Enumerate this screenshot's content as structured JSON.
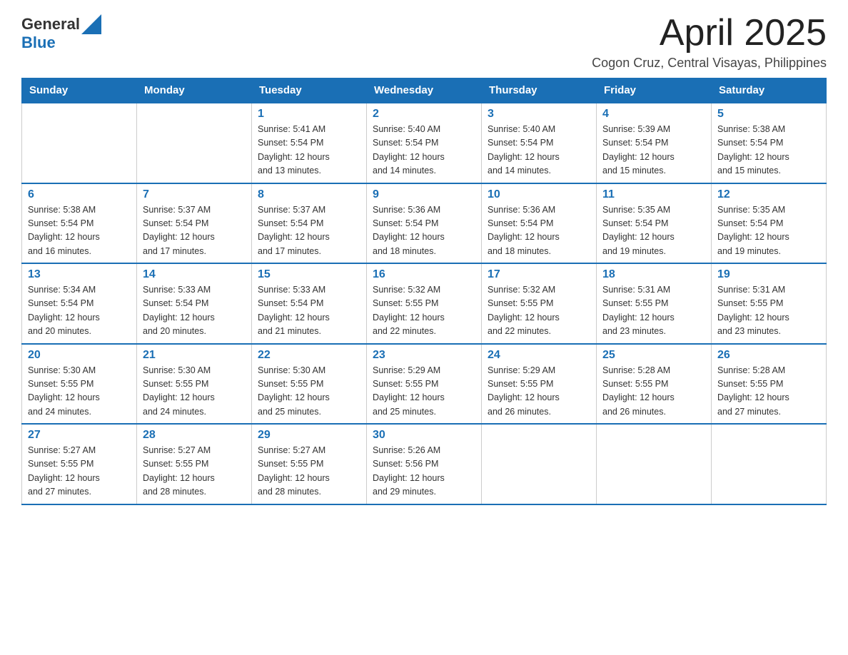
{
  "logo": {
    "text_general": "General",
    "text_blue": "Blue",
    "alt": "GeneralBlue logo"
  },
  "header": {
    "month_year": "April 2025",
    "location": "Cogon Cruz, Central Visayas, Philippines"
  },
  "weekdays": [
    "Sunday",
    "Monday",
    "Tuesday",
    "Wednesday",
    "Thursday",
    "Friday",
    "Saturday"
  ],
  "weeks": [
    [
      {
        "day": "",
        "info": ""
      },
      {
        "day": "",
        "info": ""
      },
      {
        "day": "1",
        "info": "Sunrise: 5:41 AM\nSunset: 5:54 PM\nDaylight: 12 hours\nand 13 minutes."
      },
      {
        "day": "2",
        "info": "Sunrise: 5:40 AM\nSunset: 5:54 PM\nDaylight: 12 hours\nand 14 minutes."
      },
      {
        "day": "3",
        "info": "Sunrise: 5:40 AM\nSunset: 5:54 PM\nDaylight: 12 hours\nand 14 minutes."
      },
      {
        "day": "4",
        "info": "Sunrise: 5:39 AM\nSunset: 5:54 PM\nDaylight: 12 hours\nand 15 minutes."
      },
      {
        "day": "5",
        "info": "Sunrise: 5:38 AM\nSunset: 5:54 PM\nDaylight: 12 hours\nand 15 minutes."
      }
    ],
    [
      {
        "day": "6",
        "info": "Sunrise: 5:38 AM\nSunset: 5:54 PM\nDaylight: 12 hours\nand 16 minutes."
      },
      {
        "day": "7",
        "info": "Sunrise: 5:37 AM\nSunset: 5:54 PM\nDaylight: 12 hours\nand 17 minutes."
      },
      {
        "day": "8",
        "info": "Sunrise: 5:37 AM\nSunset: 5:54 PM\nDaylight: 12 hours\nand 17 minutes."
      },
      {
        "day": "9",
        "info": "Sunrise: 5:36 AM\nSunset: 5:54 PM\nDaylight: 12 hours\nand 18 minutes."
      },
      {
        "day": "10",
        "info": "Sunrise: 5:36 AM\nSunset: 5:54 PM\nDaylight: 12 hours\nand 18 minutes."
      },
      {
        "day": "11",
        "info": "Sunrise: 5:35 AM\nSunset: 5:54 PM\nDaylight: 12 hours\nand 19 minutes."
      },
      {
        "day": "12",
        "info": "Sunrise: 5:35 AM\nSunset: 5:54 PM\nDaylight: 12 hours\nand 19 minutes."
      }
    ],
    [
      {
        "day": "13",
        "info": "Sunrise: 5:34 AM\nSunset: 5:54 PM\nDaylight: 12 hours\nand 20 minutes."
      },
      {
        "day": "14",
        "info": "Sunrise: 5:33 AM\nSunset: 5:54 PM\nDaylight: 12 hours\nand 20 minutes."
      },
      {
        "day": "15",
        "info": "Sunrise: 5:33 AM\nSunset: 5:54 PM\nDaylight: 12 hours\nand 21 minutes."
      },
      {
        "day": "16",
        "info": "Sunrise: 5:32 AM\nSunset: 5:55 PM\nDaylight: 12 hours\nand 22 minutes."
      },
      {
        "day": "17",
        "info": "Sunrise: 5:32 AM\nSunset: 5:55 PM\nDaylight: 12 hours\nand 22 minutes."
      },
      {
        "day": "18",
        "info": "Sunrise: 5:31 AM\nSunset: 5:55 PM\nDaylight: 12 hours\nand 23 minutes."
      },
      {
        "day": "19",
        "info": "Sunrise: 5:31 AM\nSunset: 5:55 PM\nDaylight: 12 hours\nand 23 minutes."
      }
    ],
    [
      {
        "day": "20",
        "info": "Sunrise: 5:30 AM\nSunset: 5:55 PM\nDaylight: 12 hours\nand 24 minutes."
      },
      {
        "day": "21",
        "info": "Sunrise: 5:30 AM\nSunset: 5:55 PM\nDaylight: 12 hours\nand 24 minutes."
      },
      {
        "day": "22",
        "info": "Sunrise: 5:30 AM\nSunset: 5:55 PM\nDaylight: 12 hours\nand 25 minutes."
      },
      {
        "day": "23",
        "info": "Sunrise: 5:29 AM\nSunset: 5:55 PM\nDaylight: 12 hours\nand 25 minutes."
      },
      {
        "day": "24",
        "info": "Sunrise: 5:29 AM\nSunset: 5:55 PM\nDaylight: 12 hours\nand 26 minutes."
      },
      {
        "day": "25",
        "info": "Sunrise: 5:28 AM\nSunset: 5:55 PM\nDaylight: 12 hours\nand 26 minutes."
      },
      {
        "day": "26",
        "info": "Sunrise: 5:28 AM\nSunset: 5:55 PM\nDaylight: 12 hours\nand 27 minutes."
      }
    ],
    [
      {
        "day": "27",
        "info": "Sunrise: 5:27 AM\nSunset: 5:55 PM\nDaylight: 12 hours\nand 27 minutes."
      },
      {
        "day": "28",
        "info": "Sunrise: 5:27 AM\nSunset: 5:55 PM\nDaylight: 12 hours\nand 28 minutes."
      },
      {
        "day": "29",
        "info": "Sunrise: 5:27 AM\nSunset: 5:55 PM\nDaylight: 12 hours\nand 28 minutes."
      },
      {
        "day": "30",
        "info": "Sunrise: 5:26 AM\nSunset: 5:56 PM\nDaylight: 12 hours\nand 29 minutes."
      },
      {
        "day": "",
        "info": ""
      },
      {
        "day": "",
        "info": ""
      },
      {
        "day": "",
        "info": ""
      }
    ]
  ]
}
